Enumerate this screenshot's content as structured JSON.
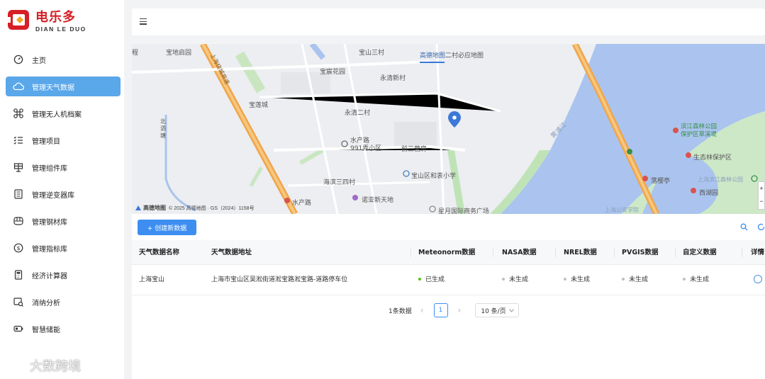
{
  "brand": {
    "name_cn": "电乐多",
    "name_en": "DIAN LE DUO",
    "color": "#d61f26"
  },
  "sidebar": {
    "items": [
      {
        "label": "主页",
        "icon": "dashboard-gauge-icon",
        "active": false
      },
      {
        "label": "管理天气数据",
        "icon": "cloud-icon",
        "active": true
      },
      {
        "label": "管理无人机档案",
        "icon": "drone-icon",
        "active": false
      },
      {
        "label": "管理项目",
        "icon": "checklist-icon",
        "active": false
      },
      {
        "label": "管理组件库",
        "icon": "solar-panel-icon",
        "active": false
      },
      {
        "label": "管理逆变器库",
        "icon": "inverter-icon",
        "active": false
      },
      {
        "label": "管理钢材库",
        "icon": "steel-icon",
        "active": false
      },
      {
        "label": "管理指标库",
        "icon": "dollar-circle-icon",
        "active": false
      },
      {
        "label": "经济计算器",
        "icon": "calculator-icon",
        "active": false
      },
      {
        "label": "消纳分析",
        "icon": "analysis-icon",
        "active": false
      },
      {
        "label": "智慧储能",
        "icon": "battery-icon",
        "active": false
      }
    ],
    "active_color": "#5aa7ea"
  },
  "watermark": "大数跨境",
  "map": {
    "labels": {
      "baodi_qidian": "宝地启园",
      "baoshan_sancun": "宝山三村",
      "baochen_huayuan": "宝宸花园",
      "yongqing_xincun": "永清新村",
      "baolian_cheng": "宝莲城",
      "yongqing_ercun": "永清二村",
      "shuichan_lu_991": "水产路\n991弄小区",
      "qiansan_yingfang": "前三营房",
      "haibin_sancun": "海滨三四村",
      "baoshan_school": "宝山区和衷小学",
      "nuoya_xintiandi": "诺亚新天地",
      "shuichan_lu": "水产路",
      "xingyue_plaza": "星月国际商务广场",
      "huangpu_jiang": "黄浦江",
      "forest_park": "滨江森林公园\n保护区草溪堤",
      "eco_reserve": "生态林保护区",
      "luoying_ting": "落樱亭",
      "xihu_yuan": "西湖园",
      "shanghai_park": "上海滨江森林公园",
      "beidi_lu": "北泗塘",
      "gaode_layer": "高德地图",
      "mini_map": "二村必应地图",
      "tongji_road": "上海绕城高速",
      "police_school": "上海公安学院",
      "left_edge": "程"
    },
    "footer": {
      "logo": "高德地图",
      "copyright": "© 2025 高德地图 · GS（2024）1158号"
    },
    "water_color": "#aac4ef",
    "road_color": "#f0a54a"
  },
  "toolbar": {
    "create_label": "+ 创建新数据"
  },
  "table": {
    "columns": [
      "天气数据名称",
      "天气数据地址",
      "Meteonorm数据",
      "NASA数据",
      "NREL数据",
      "PVGIS数据",
      "自定义数据",
      "详情"
    ],
    "rows": [
      {
        "name": "上海宝山",
        "address": "上海市宝山区吴淞街道淞宝路淞宝路-道路停车位",
        "meteonorm": "已生成",
        "nasa": "未生成",
        "nrel": "未生成",
        "pvgis": "未生成",
        "custom": "未生成"
      }
    ],
    "status_colors": {
      "generated": "#52c41a",
      "not_generated": "#bfbfbf"
    }
  },
  "pagination": {
    "total_label": "1条数据",
    "current_page": "1",
    "page_size": "10 条/页",
    "prev": "‹",
    "next": "›"
  }
}
